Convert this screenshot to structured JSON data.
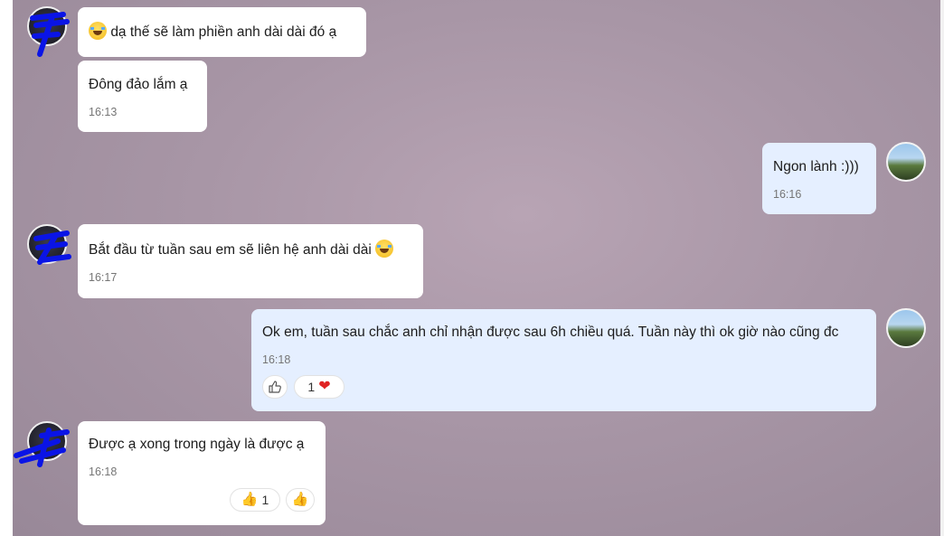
{
  "messages": [
    {
      "text": "dạ thế sẽ làm phiền anh dài dài đó ạ",
      "emoji": "joy-emoji"
    },
    {
      "text": "Đông đảo lắm ạ",
      "time": "16:13"
    },
    {
      "text": "Ngon lành :)))",
      "time": "16:16"
    },
    {
      "text": "Bắt đầu từ tuần sau em sẽ liên hệ anh dài dài",
      "time": "16:17",
      "emoji": "joy-emoji"
    },
    {
      "text": "Ok em, tuần sau chắc anh chỉ nhận được sau 6h chiều quá. Tuần này thì ok giờ nào cũng đc",
      "time": "16:18",
      "reaction_count": "1",
      "reaction_icon": "heart-icon"
    },
    {
      "text": "Được ạ xong trong ngày là được ạ",
      "time": "16:18",
      "reaction_count": "1",
      "reaction_icon": "thumbs-up-icon"
    }
  ],
  "colors": {
    "incoming_bubble": "#ffffff",
    "outgoing_bubble": "#e5efff",
    "timestamp": "#757575",
    "heart": "#e02424"
  }
}
